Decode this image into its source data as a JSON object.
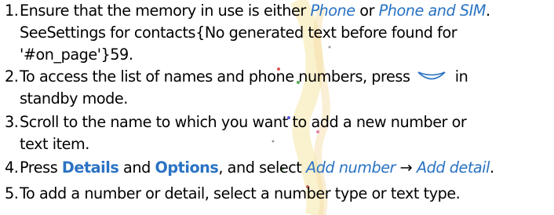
{
  "steps": [
    {
      "number": "1.",
      "line1_a": "Ensure that the memory in use is either ",
      "line1_phone": "Phone",
      "line1_or": " or ",
      "line1_phone_sim": "Phone and SIM",
      "line1_end": ".",
      "line2": "SeeSettings for contacts{No generated text before found for",
      "line3": "'#on_page'}59."
    },
    {
      "number": "2.",
      "line1_a": "To access the list of names and phone numbers, press ",
      "line1_b": " in",
      "line2": "standby mode.",
      "icon": "end-key-icon"
    },
    {
      "number": "3.",
      "line1": "Scroll to the name to which you want to add a new number or",
      "line2": "text item."
    },
    {
      "number": "4.",
      "text_a": "Press ",
      "details": "Details",
      "text_and": " and ",
      "options": "Options",
      "text_select": ", and select ",
      "add_number": "Add number",
      "arrow": " → ",
      "add_detail": "Add detail",
      "end": "."
    },
    {
      "number": "5.",
      "line1": "To add a number or detail, select a number type or text type."
    }
  ],
  "colors": {
    "text": "#000000",
    "link": "#2a73c3"
  }
}
